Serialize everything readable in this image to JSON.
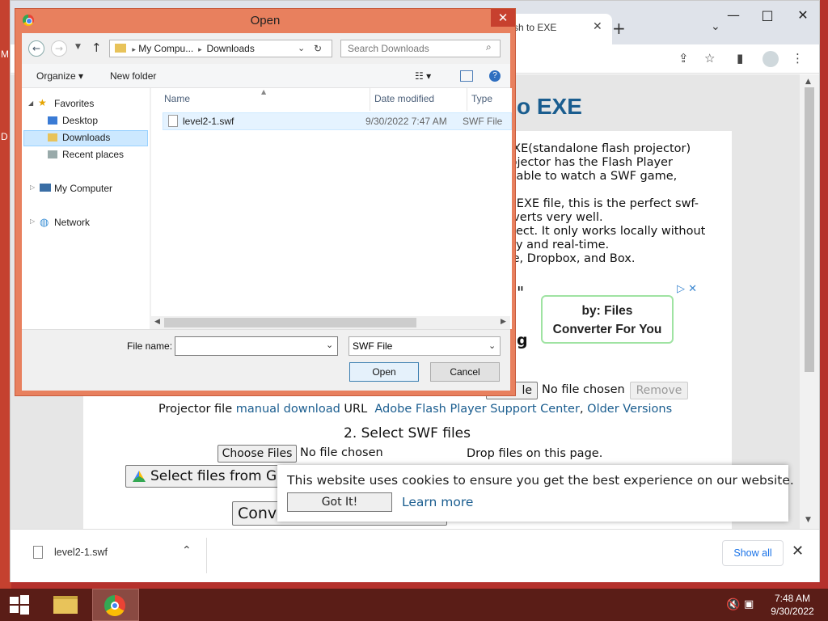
{
  "desktop": {
    "edge_letters": [
      "M",
      "D"
    ]
  },
  "browser": {
    "tab_title": "sh to EXE",
    "tab_close": "✕",
    "new_tab": "+",
    "window_controls": {
      "minimize": "—",
      "maximize": "□",
      "close": "✕"
    }
  },
  "page": {
    "heading": "o EXE",
    "desc_lines": [
      "EXE(standalone flash projector)",
      "rojector has the Flash Player",
      "e able to watch a SWF game,",
      "",
      "n EXE file, this is the perfect swf-",
      "nverts very well.",
      "elect. It only works locally without",
      "ely and real-time.",
      "ve, Dropbox, and Box."
    ],
    "quote_mark": "\"",
    "heading_frag": "g",
    "ad": {
      "line1": "by: Files",
      "line2": "Converter For You"
    },
    "projector": {
      "file_btn_frag": "le",
      "no_file": "No file chosen",
      "remove": "Remove",
      "label": "Projector file",
      "manual_download": "manual download",
      "url_label": "URL",
      "adobe_link": "Adobe Flash Player Support Center",
      "comma": ",",
      "older_versions": "Older Versions"
    },
    "step2": {
      "title": "2. Select SWF files",
      "choose_files": "Choose Files",
      "no_file": "No file chosen",
      "drop_hint": "Drop files on this page.",
      "gdrive": "Select files from G",
      "convert_frag": "Conv"
    },
    "cookie": {
      "text": "This website uses cookies to ensure you get the best experience on our website.",
      "button": "Got It!",
      "link": "Learn more"
    }
  },
  "downloads": {
    "item": "level2-1.swf",
    "show_all": "Show all"
  },
  "dialog": {
    "title": "Open",
    "breadcrumb": [
      "My Compu...",
      "Downloads"
    ],
    "search_placeholder": "Search Downloads",
    "commands": {
      "organize": "Organize ▾",
      "new_folder": "New folder"
    },
    "nav": {
      "favorites": "Favorites",
      "desktop": "Desktop",
      "downloads": "Downloads",
      "recent": "Recent places",
      "computer": "My Computer",
      "network": "Network"
    },
    "columns": {
      "name": "Name",
      "date": "Date modified",
      "type": "Type"
    },
    "files": [
      {
        "name": "level2-1.swf",
        "date": "9/30/2022 7:47 AM",
        "type": "SWF File"
      }
    ],
    "file_name_label": "File name:",
    "file_name_value": "",
    "file_type": "SWF File",
    "open": "Open",
    "cancel": "Cancel"
  },
  "taskbar": {
    "time": "7:48 AM",
    "date": "9/30/2022"
  }
}
